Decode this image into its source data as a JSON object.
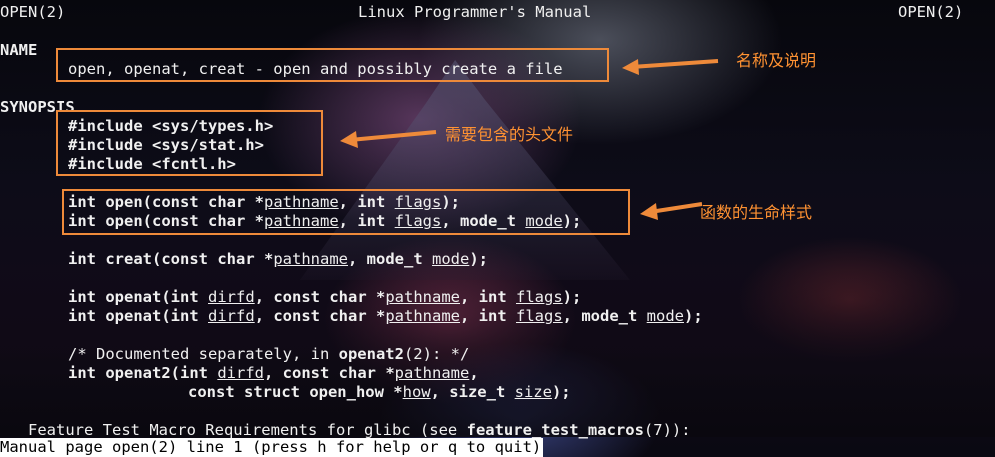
{
  "header": {
    "left": "OPEN(2)",
    "center": "Linux Programmer's Manual",
    "right": "OPEN(2)"
  },
  "sections": {
    "name": "NAME",
    "synopsis": "SYNOPSIS"
  },
  "name_line": "open, openat, creat - open and possibly create a file",
  "includes": [
    "#include <sys/types.h>",
    "#include <sys/stat.h>",
    "#include <fcntl.h>"
  ],
  "tokens": {
    "int": "int",
    "open": "open",
    "creat": "creat",
    "openat": "openat",
    "openat2": "openat2",
    "open_paren_const_char": "(const char *",
    "paren_int": "(int ",
    "comma_int": ", int ",
    "comma_const_char": ", const char *",
    "comma_mode_t": ", mode_t ",
    "comma_size_t": ", size_t ",
    "const_struct": "const struct open_how *",
    "pathname": "pathname",
    "flags": "flags",
    "mode": "mode",
    "dirfd": "dirfd",
    "how": "how",
    "size": "size",
    "close_semi": ");",
    "comma": ",",
    "comment_start": "/* Documented separately, in ",
    "comment_end": "(2): */"
  },
  "feature_line": {
    "prefix": "Feature Test Macro Requirements for glibc (see ",
    "bold": "feature_test_macros",
    "suffix": "(7)):"
  },
  "status_bar": "Manual page open(2) line 1 (press h for help or q to quit)",
  "annotations": {
    "name_note": "名称及说明",
    "header_note": "需要包含的头文件",
    "proto_note": "函数的生命样式"
  },
  "colors": {
    "annotation": "#ee8a3a",
    "annotation_text": "#ff9232",
    "text": "#f0f0f0",
    "status_bg": "#ffffff"
  }
}
